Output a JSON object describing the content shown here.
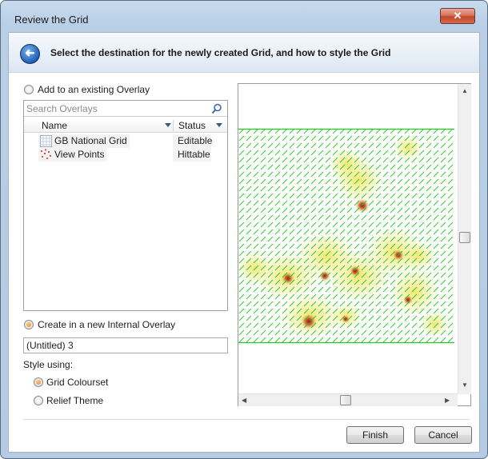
{
  "window": {
    "title": "Review the Grid",
    "close_glyph": "✕"
  },
  "header": {
    "back_glyph": "➜",
    "text": "Select the destination for the newly created Grid, and how to style the Grid"
  },
  "destination": {
    "existing_label": "Add to an existing Overlay",
    "existing_selected": false,
    "search_placeholder": "Search Overlays",
    "columns": {
      "name": "Name",
      "status": "Status"
    },
    "overlays": [
      {
        "name": "GB National Grid",
        "status": "Editable",
        "icon": "grid-layer-icon"
      },
      {
        "name": "View Points",
        "status": "Hittable",
        "icon": "points-layer-icon"
      }
    ],
    "new_label": "Create in a new Internal Overlay",
    "new_selected": true,
    "new_name_value": "(Untitled) 3"
  },
  "style": {
    "label": "Style using:",
    "options": [
      {
        "label": "Grid Colourset",
        "selected": true
      },
      {
        "label": "Relief Theme",
        "selected": false
      }
    ]
  },
  "buttons": {
    "finish": "Finish",
    "cancel": "Cancel"
  },
  "colors": {
    "grid_line": "#22c922",
    "selected_radio": "#e07a12",
    "heat_low": "#f2e86a",
    "heat_high": "#b0302a"
  }
}
